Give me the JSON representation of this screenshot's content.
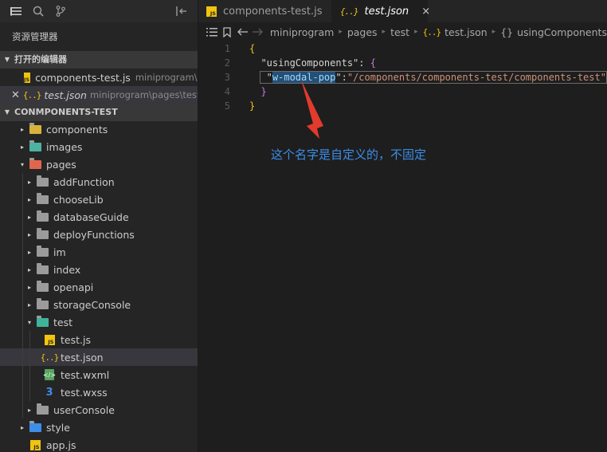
{
  "sidebar": {
    "explorer_title": "资源管理器",
    "open_editors_label": "打开的编辑器",
    "open_editors": [
      {
        "name": "components-test.js",
        "path": "miniprogram\\...",
        "icon": "js"
      },
      {
        "name": "test.json",
        "path": "miniprogram\\pages\\test",
        "icon": "json"
      }
    ],
    "project_label": "CONMPONENTS-TEST",
    "tree": [
      {
        "label": "components",
        "icon": "folder-components",
        "arrow": "▸"
      },
      {
        "label": "images",
        "icon": "folder-images",
        "arrow": "▸"
      },
      {
        "label": "pages",
        "icon": "folder-pages",
        "arrow": "▾"
      },
      {
        "label": "addFunction",
        "icon": "folder",
        "arrow": "▸"
      },
      {
        "label": "chooseLib",
        "icon": "folder",
        "arrow": "▸"
      },
      {
        "label": "databaseGuide",
        "icon": "folder",
        "arrow": "▸"
      },
      {
        "label": "deployFunctions",
        "icon": "folder",
        "arrow": "▸"
      },
      {
        "label": "im",
        "icon": "folder",
        "arrow": "▸"
      },
      {
        "label": "index",
        "icon": "folder",
        "arrow": "▸"
      },
      {
        "label": "openapi",
        "icon": "folder",
        "arrow": "▸"
      },
      {
        "label": "storageConsole",
        "icon": "folder",
        "arrow": "▸"
      },
      {
        "label": "test",
        "icon": "folder-test",
        "arrow": "▾"
      },
      {
        "label": "test.js",
        "icon": "js",
        "arrow": ""
      },
      {
        "label": "test.json",
        "icon": "json",
        "arrow": ""
      },
      {
        "label": "test.wxml",
        "icon": "wxml",
        "arrow": ""
      },
      {
        "label": "test.wxss",
        "icon": "css",
        "arrow": ""
      },
      {
        "label": "userConsole",
        "icon": "folder",
        "arrow": "▸"
      },
      {
        "label": "style",
        "icon": "folder-style",
        "arrow": "▸"
      },
      {
        "label": "app.js",
        "icon": "js",
        "arrow": ""
      }
    ]
  },
  "editor": {
    "tabs": [
      {
        "label": "components-test.js",
        "icon": "js"
      },
      {
        "label": "test.json",
        "icon": "json",
        "close": "×"
      }
    ],
    "breadcrumb": [
      "miniprogram",
      "pages",
      "test",
      "test.json",
      "usingComponents"
    ],
    "breadcrumb_json_glyph": "{..}",
    "breadcrumb_obj_glyph": "{}",
    "line_numbers": [
      "1",
      "2",
      "3",
      "4",
      "5"
    ],
    "code": {
      "open_brace": "{",
      "key": "\"usingComponents\"",
      "colon": ": ",
      "inner_open": "{",
      "comp_key": "w-modal-pop",
      "comp_value": "\"/components/components-test/components-test\"",
      "inner_close": "}",
      "close_brace": "}"
    },
    "annotation": "这个名字是自定义的，不固定"
  },
  "colors": {
    "annotation": "#3b8eea",
    "arrow": "#e23b2e",
    "js_badge": "#f1c40f",
    "selection": "#264f78"
  }
}
